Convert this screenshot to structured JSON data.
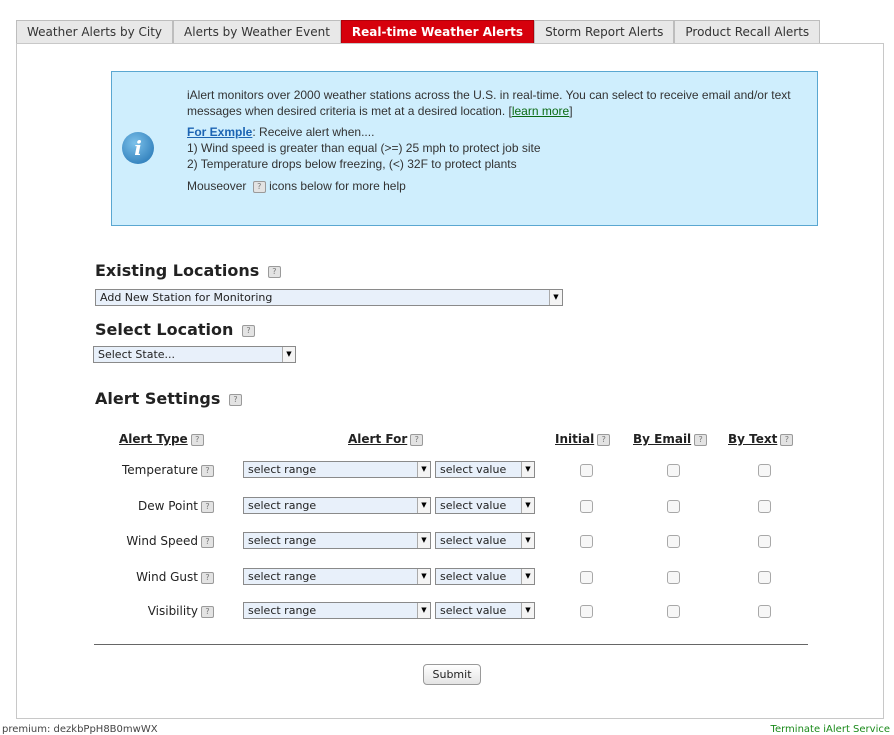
{
  "tabs": [
    {
      "label": "Weather Alerts by City"
    },
    {
      "label": "Alerts by Weather Event"
    },
    {
      "label": "Real-time Weather Alerts"
    },
    {
      "label": "Storm Report Alerts"
    },
    {
      "label": "Product Recall Alerts"
    }
  ],
  "info": {
    "intro": "iAlert monitors over 2000 weather stations across the U.S. in real-time. You can select to receive email and/or text messages when desired criteria is met at a desired location. [",
    "learn_more": "learn more",
    "intro_end": "]",
    "example_label": "For Exmple",
    "example_rest": ": Receive alert when....",
    "example1": "1) Wind speed is greater than equal (>=) 25 mph to protect job site",
    "example2": "2) Temperature drops below freezing, (<) 32F to protect plants",
    "mouseover_before": "Mouseover",
    "mouseover_after": "icons below for more help",
    "icon_letter": "i"
  },
  "help_glyph": "?",
  "existing_locations": {
    "heading": "Existing Locations",
    "selected": "Add New Station for Monitoring"
  },
  "select_location": {
    "heading": "Select Location",
    "selected": "Select State..."
  },
  "alert_settings": {
    "heading": "Alert Settings",
    "columns": {
      "alert_type": "Alert Type",
      "alert_for": "Alert For",
      "initial": "Initial",
      "by_email": "By Email",
      "by_text": "By Text"
    },
    "rows": [
      {
        "label": "Temperature",
        "range": "select range",
        "value": "select value"
      },
      {
        "label": "Dew Point",
        "range": "select range",
        "value": "select value"
      },
      {
        "label": "Wind Speed",
        "range": "select range",
        "value": "select value"
      },
      {
        "label": "Wind Gust",
        "range": "select range",
        "value": "select value"
      },
      {
        "label": "Visibility",
        "range": "select range",
        "value": "select value"
      }
    ]
  },
  "submit_label": "Submit",
  "footer": {
    "left": "premium: dezkbPpH8B0mwWX",
    "right": "Terminate iAlert Service"
  },
  "colors": {
    "active_tab": "#d6000c",
    "info_bg": "#cfeefd",
    "info_border": "#5aa7d1",
    "link_green": "#0a6a12"
  }
}
